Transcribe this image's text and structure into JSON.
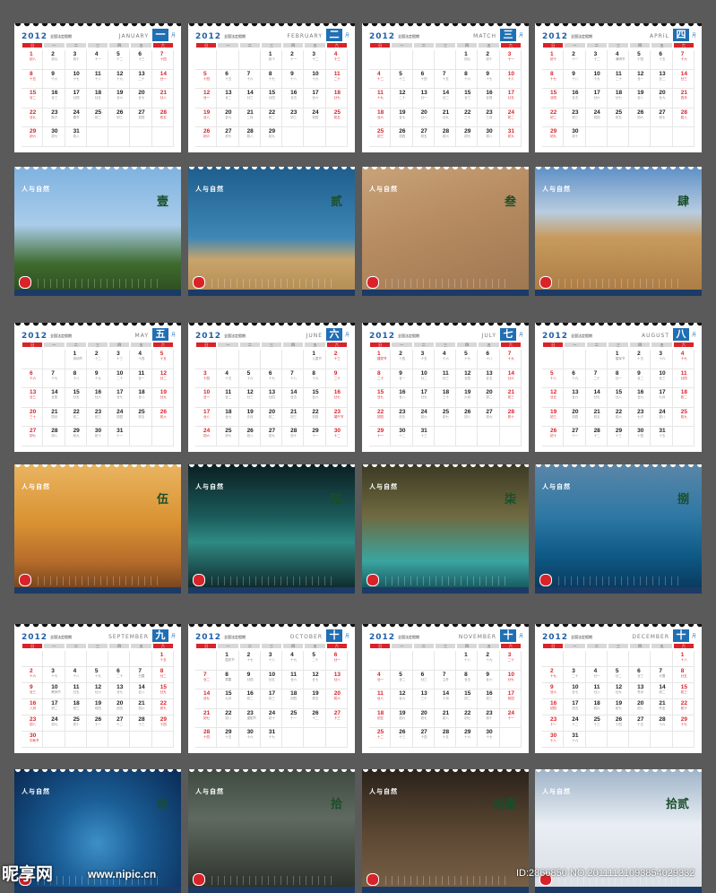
{
  "year": "2012",
  "holiday_label": "全国法定假期",
  "yue": "月",
  "weekdays": [
    "日",
    "一",
    "二",
    "三",
    "四",
    "五",
    "六"
  ],
  "months": [
    {
      "en": "JANUARY",
      "cn": "一",
      "start": 0,
      "days": 31,
      "lunar": [
        "初八",
        "初九",
        "初十",
        "十一",
        "十二",
        "十三",
        "十四",
        "十五",
        "十六",
        "十七",
        "十八",
        "十九",
        "二十",
        "廿一",
        "廿二",
        "廿三",
        "廿四",
        "廿五",
        "廿六",
        "廿七",
        "廿八",
        "廿九",
        "除夕",
        "春节",
        "初二",
        "初三",
        "初四",
        "初五",
        "初六",
        "初七",
        "初八"
      ]
    },
    {
      "en": "FEBRUARY",
      "cn": "二",
      "start": 3,
      "days": 29,
      "lunar": [
        "初十",
        "十一",
        "十二",
        "十三",
        "十四",
        "十五",
        "十六",
        "十七",
        "十八",
        "十九",
        "二十",
        "廿一",
        "廿二",
        "廿三",
        "廿四",
        "廿五",
        "廿六",
        "廿七",
        "廿八",
        "廿九",
        "二月",
        "初二",
        "初三",
        "初四",
        "初五",
        "初六",
        "初七",
        "初八",
        "初九"
      ]
    },
    {
      "en": "MATCH",
      "cn": "三",
      "start": 4,
      "days": 31,
      "lunar": [
        "初九",
        "初十",
        "十一",
        "十二",
        "十三",
        "十四",
        "十五",
        "十六",
        "十七",
        "十八",
        "十九",
        "二十",
        "廿一",
        "廿二",
        "廿三",
        "廿四",
        "廿五",
        "廿六",
        "廿七",
        "廿八",
        "廿九",
        "三十",
        "三月",
        "初二",
        "初三",
        "初四",
        "初五",
        "初六",
        "初七",
        "初八",
        "初九"
      ]
    },
    {
      "en": "APRIL",
      "cn": "四",
      "start": 0,
      "days": 30,
      "lunar": [
        "初十",
        "十一",
        "十二",
        "清明节",
        "十四",
        "十五",
        "十六",
        "十七",
        "十八",
        "十九",
        "二十",
        "廿一",
        "廿二",
        "廿三",
        "廿四",
        "廿五",
        "廿六",
        "廿七",
        "廿八",
        "廿九",
        "四月",
        "初二",
        "初三",
        "初四",
        "初五",
        "初六",
        "初七",
        "初八",
        "初九",
        "初十"
      ]
    },
    {
      "en": "MAY",
      "cn": "五",
      "start": 2,
      "days": 31,
      "lunar": [
        "劳动节",
        "十二",
        "十三",
        "十四",
        "十五",
        "十六",
        "十七",
        "十八",
        "十九",
        "二十",
        "廿一",
        "廿二",
        "廿三",
        "廿四",
        "廿五",
        "廿六",
        "廿七",
        "廿八",
        "廿九",
        "三十",
        "四月",
        "初二",
        "初三",
        "初四",
        "初五",
        "初六",
        "初七",
        "初八",
        "初九",
        "初十",
        "十一"
      ]
    },
    {
      "en": "JUNE",
      "cn": "六",
      "start": 5,
      "days": 30,
      "lunar": [
        "儿童节",
        "十三",
        "十四",
        "十五",
        "十六",
        "十七",
        "十八",
        "十九",
        "二十",
        "廿一",
        "廿二",
        "廿三",
        "廿四",
        "廿五",
        "廿六",
        "廿七",
        "廿八",
        "廿九",
        "五月",
        "初二",
        "初三",
        "初四",
        "端午节",
        "初六",
        "初七",
        "初八",
        "初九",
        "初十",
        "十一",
        "十二"
      ]
    },
    {
      "en": "JULY",
      "cn": "七",
      "start": 0,
      "days": 31,
      "lunar": [
        "建党节",
        "十四",
        "十五",
        "十六",
        "十七",
        "十八",
        "十九",
        "二十",
        "廿一",
        "廿二",
        "廿三",
        "廿四",
        "廿五",
        "廿六",
        "廿七",
        "廿八",
        "廿九",
        "三十",
        "六月",
        "初二",
        "初三",
        "初四",
        "初五",
        "初六",
        "初七",
        "初八",
        "初九",
        "初十",
        "十一",
        "十二",
        "十三"
      ]
    },
    {
      "en": "AUGUST",
      "cn": "八",
      "start": 3,
      "days": 31,
      "lunar": [
        "建军节",
        "十五",
        "十六",
        "十七",
        "十八",
        "十九",
        "二十",
        "廿一",
        "廿二",
        "廿三",
        "廿四",
        "廿五",
        "廿六",
        "廿七",
        "廿八",
        "廿九",
        "七月",
        "初二",
        "初三",
        "初四",
        "初五",
        "初六",
        "七夕",
        "初八",
        "初九",
        "初十",
        "十一",
        "十二",
        "十三",
        "十四",
        "十五"
      ]
    },
    {
      "en": "SEPTEMBER",
      "cn": "九",
      "start": 6,
      "days": 30,
      "lunar": [
        "十五",
        "十六",
        "十七",
        "十八",
        "十九",
        "二十",
        "白露",
        "廿二",
        "廿三",
        "教师节",
        "廿五",
        "廿六",
        "廿七",
        "廿八",
        "廿九",
        "八月",
        "初二",
        "初三",
        "初四",
        "初五",
        "初六",
        "初七",
        "初八",
        "初九",
        "初十",
        "十一",
        "十二",
        "十三",
        "十四",
        "中秋节"
      ]
    },
    {
      "en": "OCTOBER",
      "cn": "十",
      "start": 1,
      "days": 31,
      "lunar": [
        "国庆节",
        "十七",
        "十八",
        "十九",
        "二十",
        "廿一",
        "廿二",
        "寒露",
        "廿四",
        "廿五",
        "廿六",
        "廿七",
        "廿八",
        "廿九",
        "九月",
        "初二",
        "初三",
        "初四",
        "初五",
        "初六",
        "初七",
        "初八",
        "重阳节",
        "初十",
        "十一",
        "十二",
        "十三",
        "十四",
        "十五",
        "十六",
        "十七"
      ]
    },
    {
      "en": "NOVEMBER",
      "cn": "十一",
      "start": 4,
      "days": 30,
      "lunar": [
        "十八",
        "十九",
        "二十",
        "廿一",
        "廿二",
        "廿三",
        "立冬",
        "廿五",
        "廿六",
        "廿七",
        "廿八",
        "廿九",
        "三十",
        "十月",
        "初二",
        "初三",
        "初四",
        "初五",
        "初六",
        "初七",
        "初八",
        "初九",
        "初十",
        "十一",
        "十二",
        "十三",
        "十四",
        "十五",
        "十六",
        "十七"
      ]
    },
    {
      "en": "DECEMBER",
      "cn": "十二",
      "start": 6,
      "days": 31,
      "lunar": [
        "十八",
        "十九",
        "二十",
        "廿一",
        "廿二",
        "廿三",
        "大雪",
        "廿五",
        "廿六",
        "廿七",
        "廿八",
        "廿九",
        "冬月",
        "初二",
        "初三",
        "初四",
        "初五",
        "初六",
        "初七",
        "初八",
        "冬至",
        "初十",
        "十一",
        "十二",
        "十三",
        "十四",
        "十五",
        "十六",
        "十七",
        "十八",
        "十九"
      ]
    }
  ],
  "photos": [
    {
      "num": "壹",
      "series": "人与自然",
      "bg": "linear-gradient(180deg,#7fb2e0 0%,#a9cdea 45%,#3f6b2e 75%,#2b4a1f 100%)"
    },
    {
      "num": "贰",
      "series": "人与自然",
      "bg": "linear-gradient(180deg,#1e5e8e 0%,#3f87b5 55%,#c9a46a 72%,#b08a52 100%)"
    },
    {
      "num": "叁",
      "series": "人与自然",
      "bg": "linear-gradient(160deg,#c9a37a 0%,#b88d63 40%,#9e7650 100%)"
    },
    {
      "num": "肆",
      "series": "人与自然",
      "bg": "linear-gradient(180deg,#5d8fc6 0%,#b8cde0 35%,#c79a5c 55%,#a97a44 100%)"
    },
    {
      "num": "伍",
      "series": "人与自然",
      "bg": "linear-gradient(180deg,#e9b460 0%,#d99232 45%,#b66c2a 75%,#6b3e1c 100%)"
    },
    {
      "num": "陆",
      "series": "人与自然",
      "bg": "linear-gradient(180deg,#0b1f22 0%,#1b5a5a 40%,#2f8a84 60%,#0b1f22 100%)"
    },
    {
      "num": "柒",
      "series": "人与自然",
      "bg": "linear-gradient(180deg,#3c3a24 0%,#6f6a40 40%,#3aa5a0 75%,#114a55 100%)"
    },
    {
      "num": "捌",
      "series": "人与自然",
      "bg": "linear-gradient(180deg,#5a86a8 0%,#2e78a4 40%,#0e5a86 70%,#0a3558 100%)"
    },
    {
      "num": "玖",
      "series": "人与自然",
      "bg": "radial-gradient(circle at 50% 60%,#3e8fc7 0%,#1a5d95 40%,#0a2a55 100%)"
    },
    {
      "num": "拾",
      "series": "人与自然",
      "bg": "linear-gradient(180deg,#3f4a40 0%,#5e6a60 40%,#2a2e28 100%)"
    },
    {
      "num": "拾壹",
      "series": "人与自然",
      "bg": "linear-gradient(180deg,#2a221a 0%,#5a4632 50%,#7a6248 100%)"
    },
    {
      "num": "拾贰",
      "series": "人与自然",
      "bg": "linear-gradient(180deg,#9fb4c8 0%,#e9eef4 45%,#d8dde3 100%)"
    }
  ],
  "watermark": {
    "brand": "昵享网",
    "url": "www.nipic.cn",
    "id": "ID:2866850 NO:20111121093854029332"
  }
}
